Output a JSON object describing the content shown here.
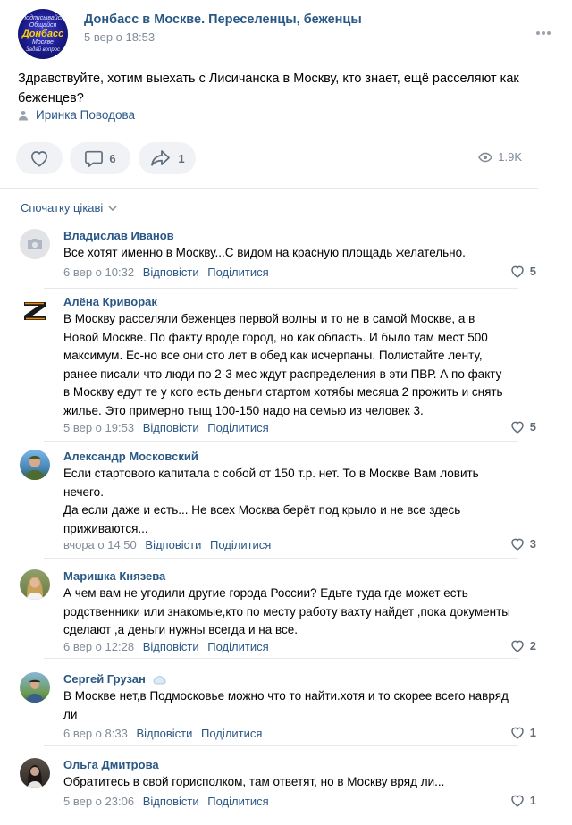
{
  "post": {
    "group_name": "Донбасс в Москве. Переселенцы, беженцы",
    "date": "5 вер о 18:53",
    "avatar_text": [
      "Подписывайся Общайся",
      "Донбасс",
      "Москве",
      "Задай вопрос"
    ],
    "text": "Здравствуйте, хотим выехать с Лисичанска в Москву, кто знает, ещё расселяют как беженцев?",
    "signer": "Иринка Поводова",
    "comments_count": "6",
    "shares_count": "1",
    "views": "1.9K"
  },
  "sort_label": "Спочатку цікаві",
  "reply_label": "Відповісти",
  "share_label": "Поділитися",
  "comments": [
    {
      "name": "Владислав Иванов",
      "text": "Все хотят именно в Москву...С видом на красную площадь желательно.",
      "time": "6 вер о 10:32",
      "likes": "5",
      "avatar": "camera"
    },
    {
      "name": "Алёна Криворак",
      "text": "В Москву расселяли беженцев первой волны и то не в самой Москве, а в Новой Москве. По факту вроде город, но как область. И было там мест 500 максимум. Ес-но все они сто лет в обед как исчерпаны. Полистайте ленту, ранее писали что люди по 2-3 мес ждут распределения в эти ПВР. А по факту в Москву едут те у кого есть деньги стартом хотябы месяца 2 прожить и снять жилье. Это примерно тыщ 100-150 надо на семью из человек 3.",
      "time": "5 вер о 19:53",
      "likes": "5",
      "avatar": "z-symbol"
    },
    {
      "name": "Александр Московский",
      "text_lines": [
        "Если стартового капитала с собой от 150 т.р. нет. То в Москве Вам ловить нечего.",
        "Да если даже и есть... Не всех Москва берёт под крыло и не все здесь приживаются..."
      ],
      "time": "вчора о 14:50",
      "likes": "3",
      "avatar": "portrait-soldier"
    },
    {
      "name": "Маришка Князева",
      "text": "А чем вам не угодили другие города России? Едьте туда где может есть родственники или знакомые,кто по месту работу вахту найдет ,пока документы сделают ,а деньги нужны всегда и на все.",
      "time": "6 вер о 12:28",
      "likes": "2",
      "avatar": "portrait-woman"
    },
    {
      "name": "Сергей Грузан",
      "badge": "cloud-emoji",
      "text": "В Москве нет,в Подмосковье можно что то найти.хотя и то скорее всего навряд ли",
      "time": "6 вер о 8:33",
      "likes": "1",
      "avatar": "portrait-outdoor"
    },
    {
      "name": "Ольга Дмитрова",
      "text": "Обратитесь в свой горисполком, там ответят, но в Москву вряд ли...",
      "time": "5 вер о 23:06",
      "likes": "1",
      "avatar": "portrait-dark"
    }
  ],
  "colors": {
    "link": "#2a5885",
    "meta": "#818c99",
    "pill": "#f0f2f5"
  }
}
